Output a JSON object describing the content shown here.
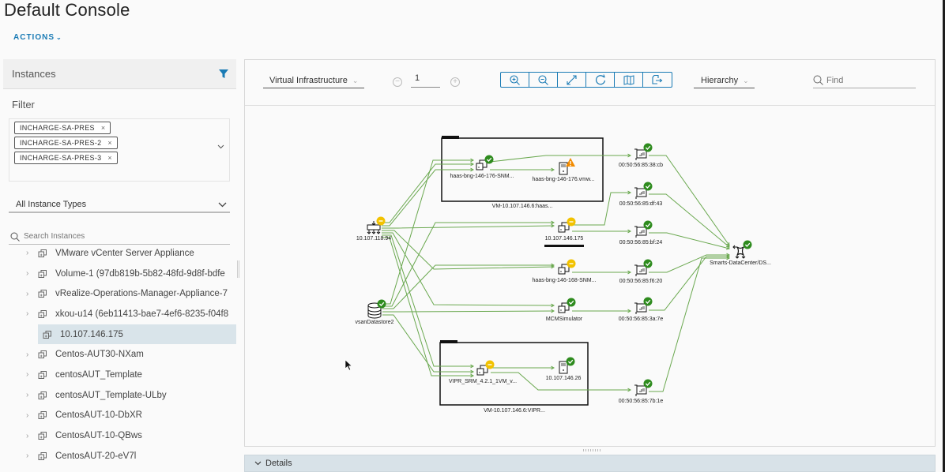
{
  "app": {
    "title": "Default Console",
    "actions_label": "ACTIONS"
  },
  "sidebar": {
    "header": "Instances",
    "filter_label": "Filter",
    "tags": [
      "INCHARGE-SA-PRES",
      "INCHARGE-SA-PRES-2",
      "INCHARGE-SA-PRES-3"
    ],
    "type_select": "All Instance Types",
    "search_placeholder": "Search Instances",
    "items": [
      {
        "label": "VMware vCenter Server Appliance",
        "selected": false
      },
      {
        "label": "Volume-1 (97db819b-5b82-48fd-9d8f-bdfe",
        "selected": false
      },
      {
        "label": "vRealize-Operations-Manager-Appliance-7",
        "selected": false
      },
      {
        "label": "xkou-u14 (6eb11413-bae7-4ef6-8235-f04f8",
        "selected": false
      },
      {
        "label": "10.107.146.175",
        "selected": true
      },
      {
        "label": "Centos-AUT30-NXam",
        "selected": false
      },
      {
        "label": "centosAUT_Template",
        "selected": false
      },
      {
        "label": "centosAUT_Template-ULby",
        "selected": false
      },
      {
        "label": "CentosAUT-10-DbXR",
        "selected": false
      },
      {
        "label": "CentosAUT-10-QBws",
        "selected": false
      },
      {
        "label": "CentosAUT-20-eV7l",
        "selected": false
      }
    ]
  },
  "toolbar": {
    "view_select": "Virtual Infrastructure",
    "zoom_level": "1",
    "buttons": [
      "zoom-in",
      "zoom-out",
      "fit-to-screen",
      "refresh",
      "map",
      "export"
    ],
    "layout_select": "Hierarchy",
    "find_placeholder": "Find"
  },
  "topology": {
    "groups": [
      {
        "id": "g1",
        "label": "VM-10.107.146.6:haas..."
      },
      {
        "id": "g2",
        "label": "VM-10.107.146.6:VIPR..."
      }
    ],
    "nodes": [
      {
        "id": "host",
        "label": "10.107.118.94",
        "type": "host",
        "status": "warning-minor"
      },
      {
        "id": "ds",
        "label": "vsanDatastore2",
        "type": "datastore",
        "status": "ok"
      },
      {
        "id": "vm1",
        "label": "haas-bng-146-176-SNM...",
        "type": "vm",
        "status": "ok"
      },
      {
        "id": "srv1",
        "label": "haas-bng-146-176.vmw...",
        "type": "server",
        "status": "warning"
      },
      {
        "id": "vm2",
        "label": "10.107.146.175",
        "type": "vm",
        "status": "warning-minor",
        "selected": true
      },
      {
        "id": "vm3",
        "label": "haas-bng-146-168-SNM...",
        "type": "vm",
        "status": "warning-minor"
      },
      {
        "id": "vm4",
        "label": "MCMSimulator",
        "type": "vm",
        "status": "ok"
      },
      {
        "id": "vm5",
        "label": "VIPR_SRM_4.2.1_1VM_v...",
        "type": "vm",
        "status": "warning-minor"
      },
      {
        "id": "srv2",
        "label": "10.107.146.26",
        "type": "server",
        "status": "ok"
      },
      {
        "id": "nic1",
        "label": "00:50:56:85:38:cb",
        "type": "nic",
        "status": "ok"
      },
      {
        "id": "nic2",
        "label": "00:50:56:85:df:43",
        "type": "nic",
        "status": "ok"
      },
      {
        "id": "nic3",
        "label": "00:50:56:85:bf:24",
        "type": "nic",
        "status": "ok"
      },
      {
        "id": "nic4",
        "label": "00:50:56:85:f6:20",
        "type": "nic",
        "status": "ok"
      },
      {
        "id": "nic5",
        "label": "00:50:56:85:3a:7e",
        "type": "nic",
        "status": "ok"
      },
      {
        "id": "nic6",
        "label": "00:50:56:85:7b:1e",
        "type": "nic",
        "status": "ok"
      },
      {
        "id": "sw",
        "label": "Smarts-DataCenter/DS...",
        "type": "switch",
        "status": "ok"
      }
    ],
    "status_colors": {
      "ok": "#2e8b1e",
      "warning": "#f28b00",
      "warning-minor": "#f2c200"
    },
    "edge_color": "#6aa84f"
  },
  "details": {
    "label": "Details"
  }
}
